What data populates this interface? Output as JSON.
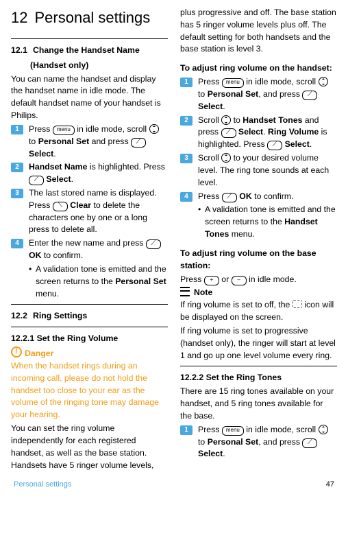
{
  "chapter": {
    "number": "12",
    "title": "Personal settings"
  },
  "s12_1": {
    "num": "12.1",
    "title_l1": "Change the Handset Name",
    "title_l2": "(Handset only)",
    "intro": "You can name the handset and display the handset name in idle mode. The default handset name of your handset is Philips.",
    "step1_a": "Press ",
    "step1_b": " in idle mode, scroll ",
    "step1_c": " to ",
    "step1_d": "Personal Set",
    "step1_e": " and press ",
    "step1_f": "Select",
    "step1_g": ".",
    "step2_a": "Handset Name",
    "step2_b": " is highlighted. Press ",
    "step2_c": "Select",
    "step2_d": ".",
    "step3_a": "The last stored name is displayed. Press ",
    "step3_b": "Clear",
    "step3_c": " to delete the characters one by one or a long press to delete all.",
    "step4_a": "Enter the new name and press ",
    "step4_b": "OK",
    "step4_c": " to confirm.",
    "bullet_a": "A validation tone is emitted and the screen returns to the ",
    "bullet_b": "Personal Set",
    "bullet_c": " menu.",
    "menu_key": "menu"
  },
  "s12_2": {
    "num": "12.2",
    "title": "Ring Settings"
  },
  "s12_2_1": {
    "head": "12.2.1 Set the Ring Volume",
    "danger_label": "Danger",
    "danger_text": "When the handset rings during an incoming call, please do not hold the handset too close to your ear as the volume of the ringing tone may damage your hearing.",
    "p1": "You can set the ring volume independently for each registered handset, as well as the base station. Handsets have 5 ringer volume levels,",
    "p1b": "plus progressive and off. The base station has 5 ringer volume levels plus off. The default setting for both handsets and the base station is level 3.",
    "hs_head": "To adjust ring volume on the handset:",
    "hs1_a": "Press ",
    "hs1_b": " in idle mode, scroll ",
    "hs1_c": " to ",
    "hs1_d": "Personal Set",
    "hs1_e": ", and press ",
    "hs1_f": "Select",
    "hs1_g": ".",
    "hs2_a": "Scroll ",
    "hs2_b": " to ",
    "hs2_c": "Handset Tones",
    "hs2_d": " and press ",
    "hs2_e": "Select",
    "hs2_f": ". ",
    "hs2_g": "Ring Volume",
    "hs2_h": " is highlighted. Press ",
    "hs2_i": "Select",
    "hs2_j": ".",
    "hs3_a": "Scroll ",
    "hs3_b": " to your desired volume level. The ring tone sounds at each level.",
    "hs4_a": "Press ",
    "hs4_b": "OK",
    "hs4_c": " to confirm.",
    "hs_bul_a": "A validation tone is emitted and the screen returns to the ",
    "hs_bul_b": "Handset Tones",
    "hs_bul_c": " menu.",
    "bs_head": "To adjust ring volume on the base station:",
    "bs_a": "Press ",
    "bs_b": " or ",
    "bs_c": " in idle mode.",
    "plus": "+",
    "minus": "–",
    "note_label": "Note",
    "note1_a": "If ring volume is set to off, the ",
    "note1_b": " icon will be displayed on the screen.",
    "note2": "If ring volume is set to progressive (handset only), the ringer will start at level 1 and go up one level volume every ring.",
    "menu_key": "menu"
  },
  "s12_2_2": {
    "head": "12.2.2 Set the Ring Tones",
    "intro": "There are 15 ring tones available on your handset, and 5 ring tones available for the base.",
    "step1_a": "Press ",
    "step1_b": " in idle mode, scroll ",
    "step1_c": " to ",
    "step1_d": "Personal Set",
    "step1_e": ", and press ",
    "step1_f": "Select",
    "step1_g": ".",
    "menu_key": "menu"
  },
  "footer": {
    "section": "Personal settings",
    "page": "47"
  }
}
